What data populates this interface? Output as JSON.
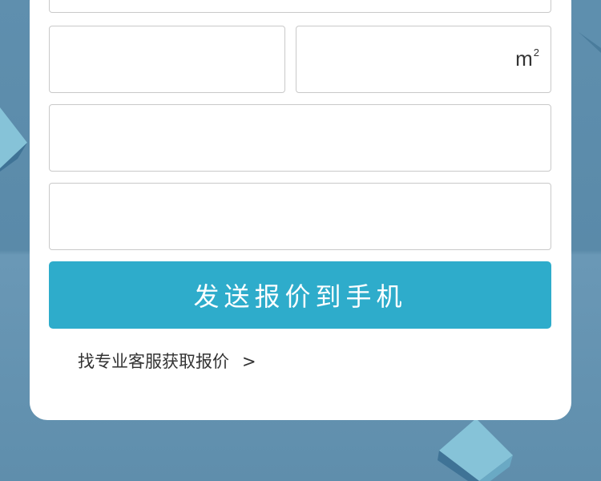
{
  "form": {
    "area_unit": "m",
    "area_unit_sup": "2",
    "submit_label": "发送报价到手机"
  },
  "footer": {
    "service_link_label": "找专业客服获取报价",
    "service_link_arrow": ">"
  },
  "colors": {
    "background": "#5f8fae",
    "card": "#ffffff",
    "submit_button": "#2eaccb",
    "input_border": "#c9c9c9",
    "cube_light": "#86c3d8",
    "cube_dark": "#3f7396"
  }
}
